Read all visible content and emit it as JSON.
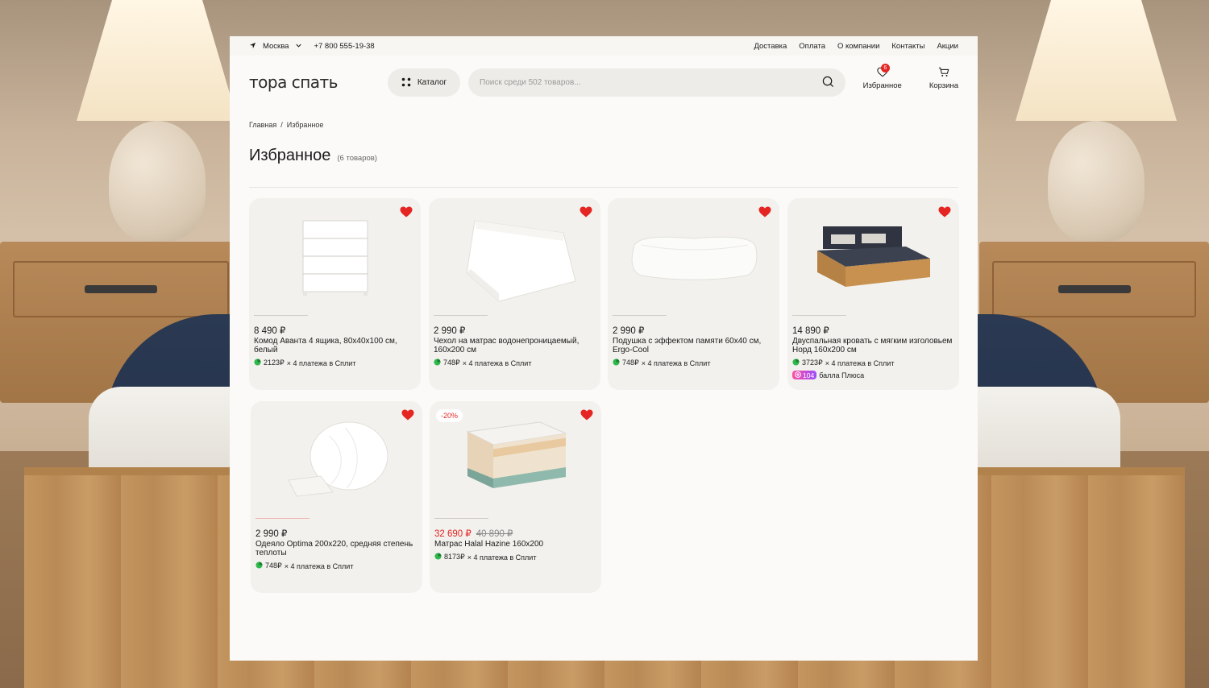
{
  "topbar": {
    "city": "Москва",
    "phone": "+7 800 555-19-38",
    "links": [
      "Доставка",
      "Оплата",
      "О компании",
      "Контакты",
      "Акции"
    ]
  },
  "header": {
    "logo": "тора спать",
    "catalog_label": "Каталог",
    "search_placeholder": "Поиск среди 502 товаров...",
    "favorites_label": "Избранное",
    "favorites_count": "6",
    "cart_label": "Корзина"
  },
  "breadcrumb": [
    "Главная",
    "Избранное"
  ],
  "breadcrumb_sep": "/",
  "page": {
    "title": "Избранное",
    "count": "(6 товаров)"
  },
  "split_suffix": "× 4 платежа в Сплит",
  "products": [
    {
      "price": "8 490 ₽",
      "name": "Комод Аванта 4 ящика, 80х40х100 см, белый",
      "split": "2123₽",
      "icon": "dresser-image"
    },
    {
      "price": "2 990 ₽",
      "name": "Чехол на матрас водонепроницаемый, 160х200 см",
      "split": "748₽",
      "icon": "mattress-cover-image"
    },
    {
      "price": "2 990 ₽",
      "name": "Подушка с эффектом памяти 60х40 см, Ergo-Cool",
      "split": "748₽",
      "icon": "pillow-image"
    },
    {
      "price": "14 890 ₽",
      "name": "Двуспальная кровать с мягким изголовьем Норд 160х200 см",
      "split": "3723₽",
      "plus_points": "104",
      "plus_label": "балла Плюса",
      "icon": "bed-image"
    },
    {
      "price": "2 990 ₽",
      "name": "Одеяло Optima 200х220, средняя степень теплоты",
      "split": "748₽",
      "icon": "duvet-image"
    },
    {
      "price": "32 690 ₽",
      "old_price": "40 890 ₽",
      "discount": "-20%",
      "name": "Матрас Halal Hazine 160х200",
      "split": "8173₽",
      "icon": "mattress-image"
    }
  ],
  "colors": {
    "accent": "#e52521",
    "split_green": "#2fb84c",
    "panel": "#fbfaf8",
    "card": "#f2f1ed"
  }
}
